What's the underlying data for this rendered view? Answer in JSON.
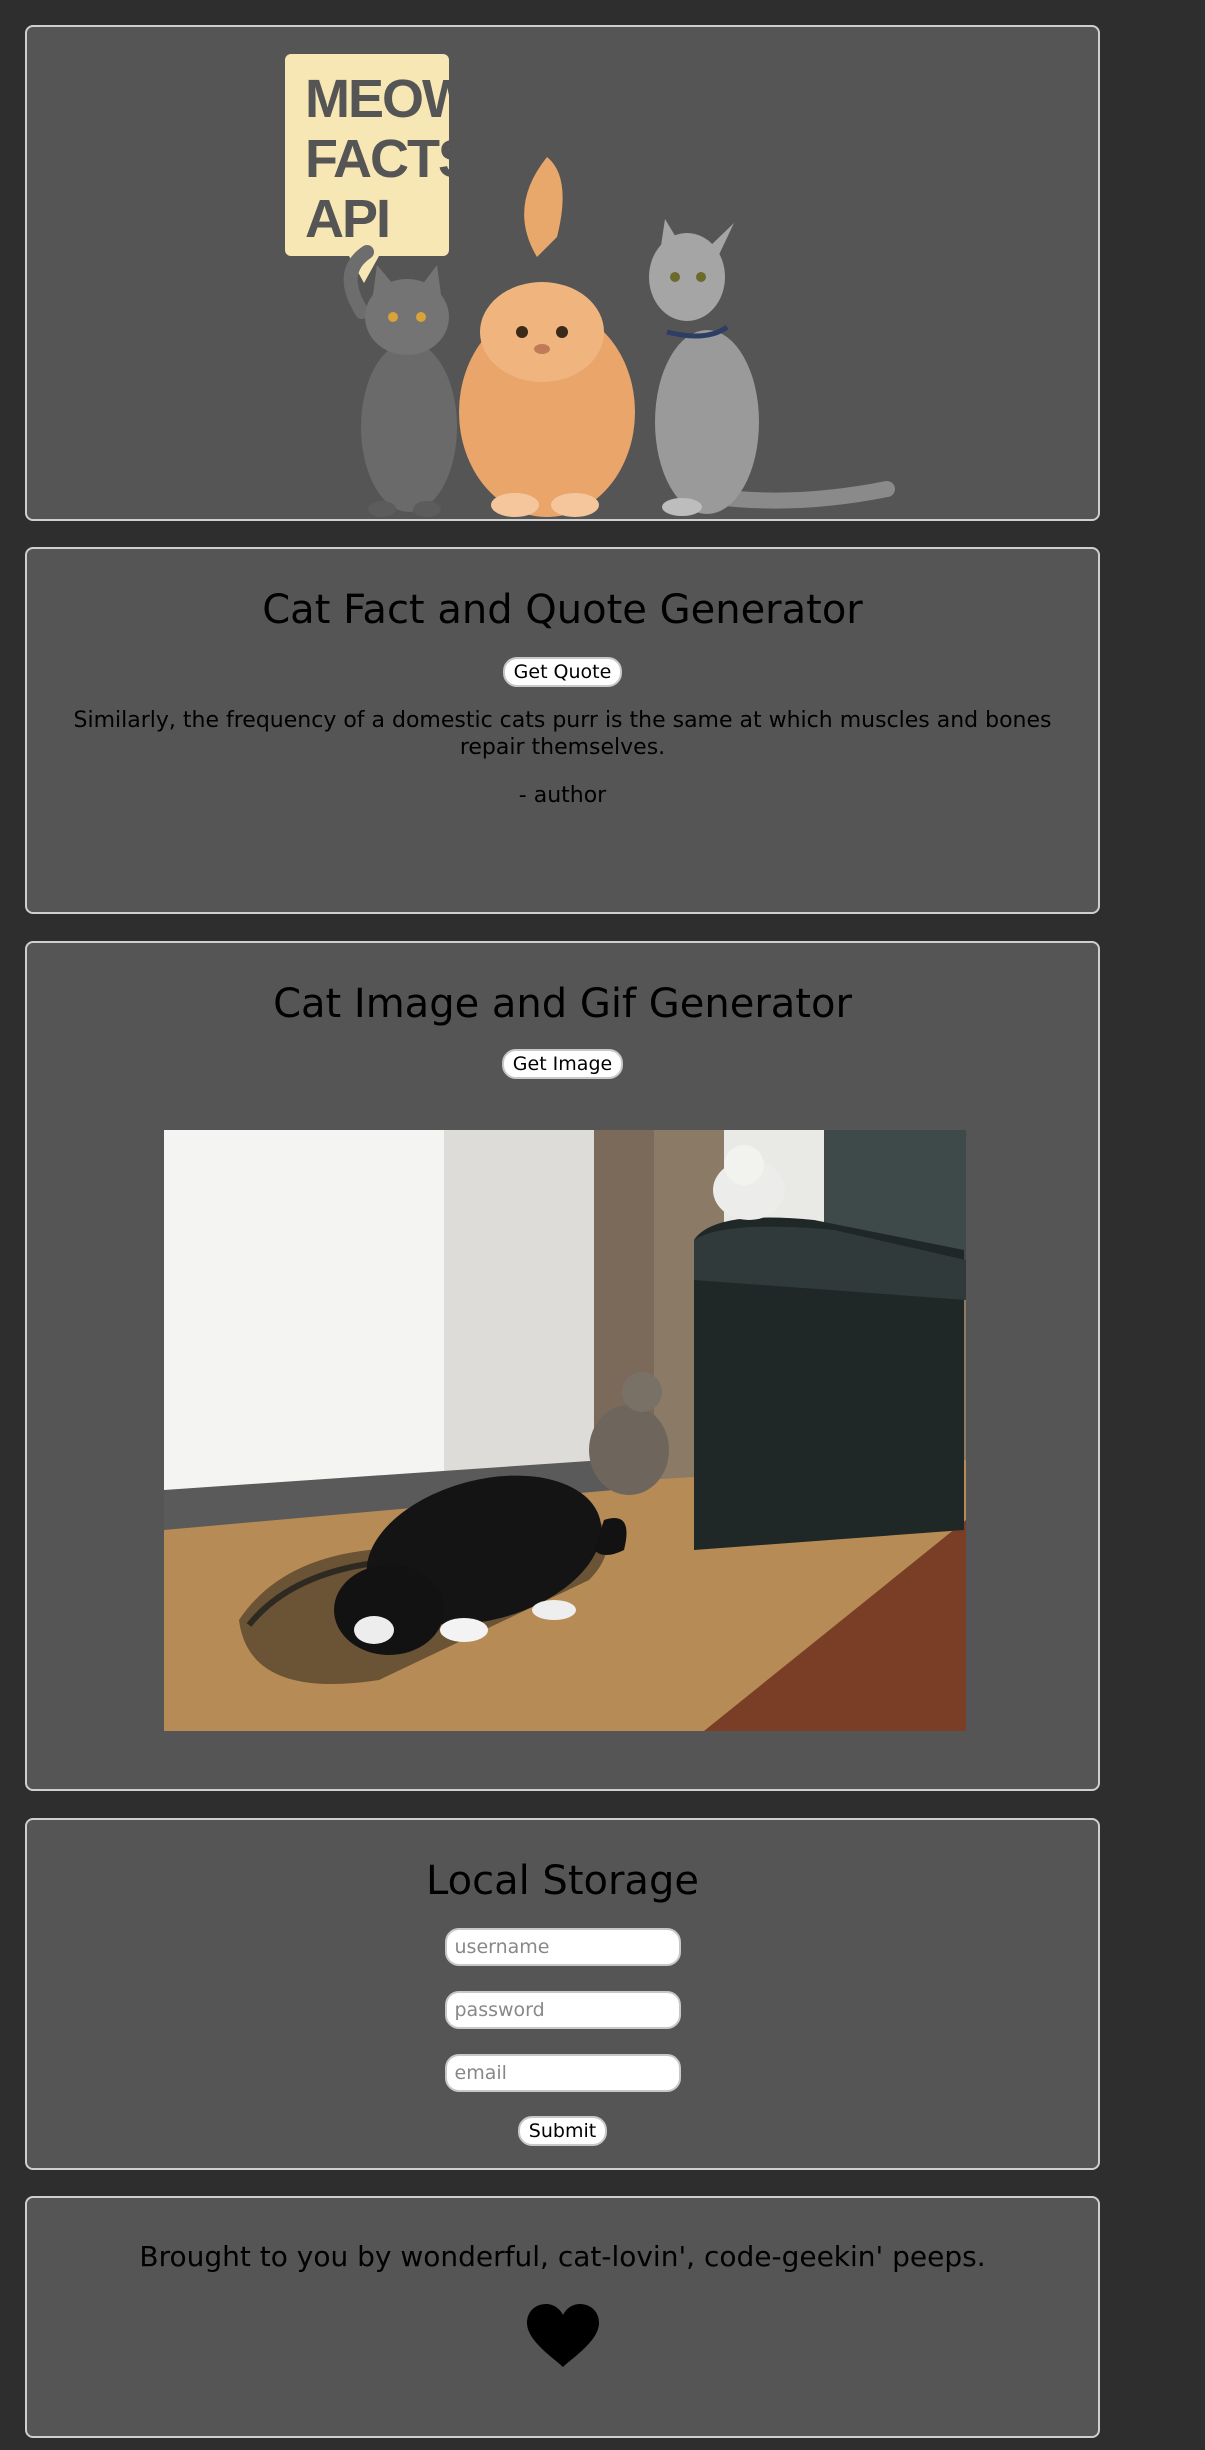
{
  "banner": {
    "logo_lines": [
      "MEOW",
      "FACTS",
      "API"
    ],
    "colors": {
      "bubble": "#f7e7b5",
      "bubble_text": "#555555"
    }
  },
  "quote": {
    "title": "Cat Fact and Quote Generator",
    "button_label": "Get Quote",
    "fact": "Similarly, the frequency of a domestic cats purr is the same at which muscles and bones repair themselves.",
    "author": "- author"
  },
  "image_gen": {
    "title": "Cat Image and Gif Generator",
    "button_label": "Get Image"
  },
  "storage": {
    "title": "Local Storage",
    "username_placeholder": "username",
    "password_placeholder": "password",
    "email_placeholder": "email",
    "submit_label": "Submit"
  },
  "footer": {
    "text": "Brought to you by wonderful, cat-lovin', code-geekin' peeps.",
    "icon": "heart-icon"
  },
  "colors": {
    "page_bg": "#2e2e2e",
    "card_bg": "#555555",
    "card_border": "#cfcfcf"
  }
}
